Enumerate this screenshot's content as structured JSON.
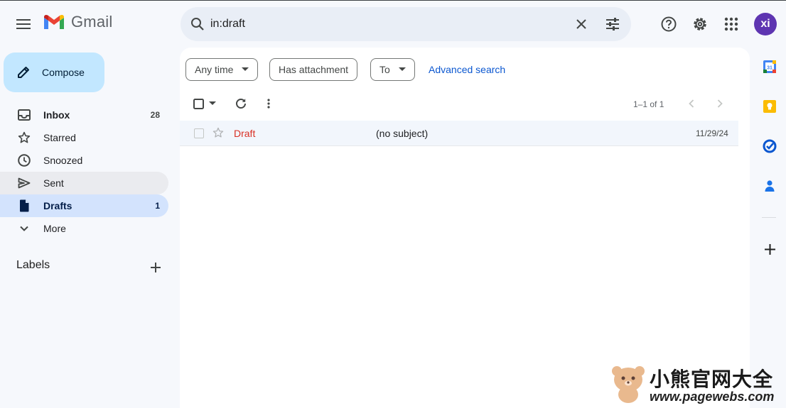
{
  "app": {
    "name": "Gmail"
  },
  "search": {
    "value": "in:draft"
  },
  "user": {
    "initials": "xi",
    "avatar_color": "#5e35b1"
  },
  "compose": {
    "label": "Compose"
  },
  "nav": {
    "items": [
      {
        "label": "Inbox",
        "count": "28",
        "icon": "inbox-icon"
      },
      {
        "label": "Starred",
        "count": "",
        "icon": "star-icon"
      },
      {
        "label": "Snoozed",
        "count": "",
        "icon": "clock-icon"
      },
      {
        "label": "Sent",
        "count": "",
        "icon": "send-icon"
      },
      {
        "label": "Drafts",
        "count": "1",
        "icon": "draft-icon"
      },
      {
        "label": "More",
        "count": "",
        "icon": "chevron-down-icon"
      }
    ]
  },
  "labels": {
    "heading": "Labels"
  },
  "filters": {
    "any_time": "Any time",
    "has_attachment": "Has attachment",
    "to": "To",
    "advanced": "Advanced search"
  },
  "pager": {
    "text": "1–1 of 1"
  },
  "messages": [
    {
      "sender": "Draft",
      "subject": "(no subject)",
      "date": "11/29/24"
    }
  ],
  "watermark": {
    "title": "小熊官网大全",
    "url": "www.pagewebs.com"
  },
  "colors": {
    "accent": "#0b57d0",
    "draft_red": "#d93025",
    "active_nav": "#d3e3fd",
    "compose_bg": "#c2e7ff"
  }
}
